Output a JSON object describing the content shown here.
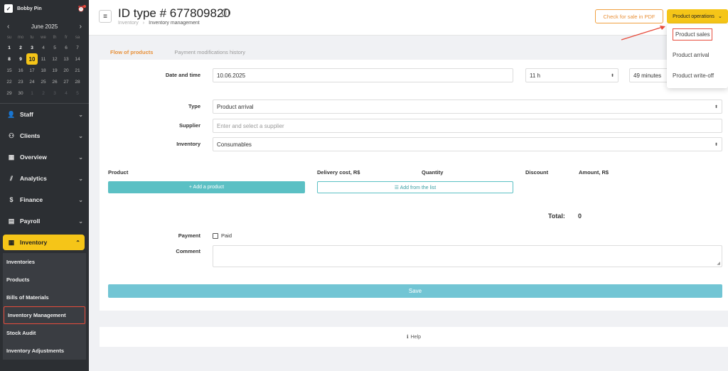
{
  "app": {
    "user_name": "Bobby Pin"
  },
  "calendar": {
    "month_label": "June 2025",
    "days_of_week": [
      "su",
      "mo",
      "tu",
      "we",
      "th",
      "fr",
      "sa"
    ],
    "weeks": [
      [
        "1",
        "2",
        "3",
        "4",
        "5",
        "6",
        "7"
      ],
      [
        "8",
        "9",
        "10",
        "11",
        "12",
        "13",
        "14"
      ],
      [
        "15",
        "16",
        "17",
        "18",
        "19",
        "20",
        "21"
      ],
      [
        "22",
        "23",
        "24",
        "25",
        "26",
        "27",
        "28"
      ],
      [
        "29",
        "30",
        "1",
        "2",
        "3",
        "4",
        "5"
      ]
    ],
    "selected": "10"
  },
  "sidebar": {
    "items": [
      {
        "label": "Staff",
        "icon": "person-icon"
      },
      {
        "label": "Clients",
        "icon": "users-icon"
      },
      {
        "label": "Overview",
        "icon": "grid-icon"
      },
      {
        "label": "Analytics",
        "icon": "chart-icon"
      },
      {
        "label": "Finance",
        "icon": "dollar-icon"
      },
      {
        "label": "Payroll",
        "icon": "payroll-icon"
      }
    ],
    "active": {
      "label": "Inventory",
      "icon": "boxes-icon"
    },
    "sub_items": [
      "Inventories",
      "Products",
      "Bills of Materials",
      "Inventory Management",
      "Stock Audit",
      "Inventory Adjustments"
    ]
  },
  "header": {
    "title": "ID type # 677809820",
    "breadcrumb": [
      "Inventory",
      "Inventory management"
    ],
    "pdf_button": "Check for sale in PDF",
    "ops_button": "Product operations"
  },
  "dropdown": {
    "items": [
      "Product sales",
      "Product arrival",
      "Product write-off"
    ]
  },
  "tabs": [
    "Flow of products",
    "Payment modifications history"
  ],
  "form": {
    "date_label": "Date and time",
    "date_value": "10.06.2025",
    "hour_value": "11 h",
    "minute_value": "49 minutes",
    "type_label": "Type",
    "type_value": "Product arrival",
    "supplier_label": "Supplier",
    "supplier_placeholder": "Enter and select a supplier",
    "inventory_label": "Inventory",
    "inventory_value": "Consumables",
    "columns": [
      "Product",
      "Delivery cost, R$",
      "Quantity",
      "Discount",
      "Amount, R$"
    ],
    "add_product": "+ Add a product",
    "add_from_list": "☰ Add from the list",
    "total_label": "Total:",
    "total_value": "0",
    "payment_label": "Payment",
    "paid_label": "Paid",
    "comment_label": "Comment",
    "save_label": "Save"
  },
  "help": {
    "label": "Help"
  },
  "colors": {
    "accent": "#f5c518",
    "teal": "#5bc0c4",
    "orange": "#e8913a",
    "highlight": "#e74c3c"
  }
}
